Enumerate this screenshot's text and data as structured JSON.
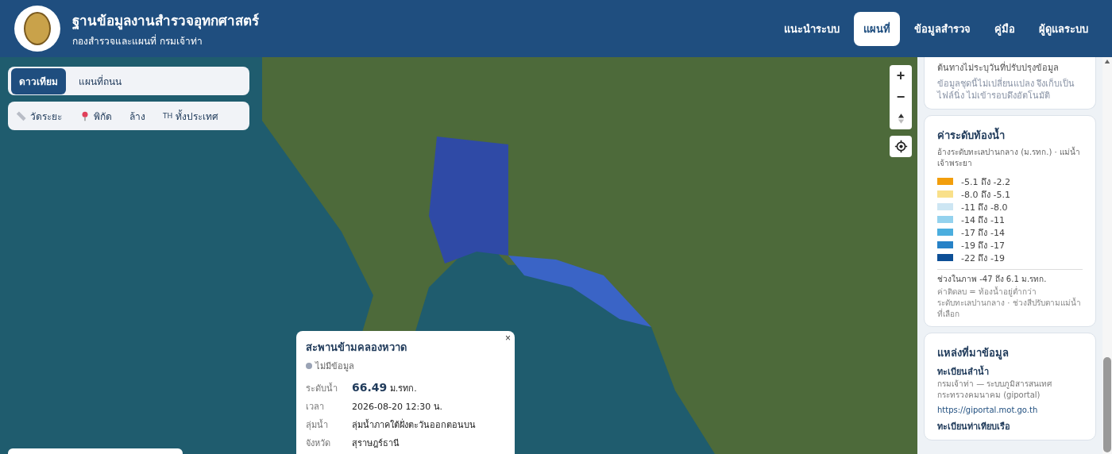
{
  "header": {
    "title": "ฐานข้อมูลงานสำรวจอุทกศาสตร์",
    "subtitle": "กองสำรวจและแผนที่ กรมเจ้าท่า"
  },
  "nav": [
    {
      "label": "แนะนำระบบ",
      "selected": false
    },
    {
      "label": "แผนที่",
      "selected": true
    },
    {
      "label": "ข้อมูลสำรวจ",
      "selected": false
    },
    {
      "label": "คู่มือ",
      "selected": false
    },
    {
      "label": "ผู้ดูแลระบบ",
      "selected": false
    }
  ],
  "basemap_tabs": [
    {
      "label": "ดาวเทียม",
      "selected": true
    },
    {
      "label": "แผนที่ถนน",
      "selected": false
    }
  ],
  "tools": [
    {
      "kind": "measure",
      "label": "วัดระยะ"
    },
    {
      "kind": "pin",
      "label": "พิกัด"
    },
    {
      "kind": "plain",
      "label": "ล้าง"
    },
    {
      "kind": "country",
      "prefix": "TH",
      "label": "ทั้งประเทศ"
    }
  ],
  "map_controls": {
    "zoom_in": "+",
    "zoom_out": "−"
  },
  "popup": {
    "title": "สะพานข้ามคลองหวาด",
    "status": "ไม่มีข้อมูล",
    "close": "×",
    "rows": [
      {
        "label": "ระดับน้ำ",
        "value": "66.49",
        "unit": "ม.รทก.",
        "kind": "level"
      },
      {
        "label": "เวลา",
        "value": "2026-08-20 12:30 น.",
        "kind": "text"
      },
      {
        "label": "ลุ่มน้ำ",
        "value": "ลุ่มน้ำภาคใต้ฝั่งตะวันออกตอนบน",
        "kind": "text"
      },
      {
        "label": "จังหวัด",
        "value": "สุราษฎร์ธานี",
        "kind": "text"
      }
    ]
  },
  "sidebar": {
    "note_card": {
      "lines": [
        "ต้นทางไม่ระบุวันที่ปรับปรุงข้อมูล",
        "ข้อมูลชุดนี้ไม่เปลี่ยนแปลง จึงเก็บเป็นไฟล์นิ่ง ไม่เข้ารอบดึงอัตโนมัติ"
      ]
    },
    "legend": {
      "title": "ค่าระดับท้องน้ำ",
      "subtitle": "อ้างระดับทะเลปานกลาง (ม.รทก.) · แม่น้ำเจ้าพระยา",
      "items": [
        {
          "label": "-5.1 ถึง -2.2",
          "color": "#f29e0c"
        },
        {
          "label": "-8.0 ถึง -5.1",
          "color": "#f9e08a"
        },
        {
          "label": "-11 ถึง -8.0",
          "color": "#cde6f3"
        },
        {
          "label": "-14 ถึง -11",
          "color": "#94d2ee"
        },
        {
          "label": "-17 ถึง -14",
          "color": "#4baede"
        },
        {
          "label": "-19 ถึง -17",
          "color": "#2782c7"
        },
        {
          "label": "-22 ถึง -19",
          "color": "#0d4f96"
        }
      ],
      "range": "ช่วงในภาพ -47 ถึง 6.1 ม.รทก.",
      "note": "ค่าติดลบ = ท้องน้ำอยู่ต่ำกว่าระดับทะเลปานกลาง · ช่วงสีปรับตามแม่น้ำที่เลือก"
    },
    "sources": {
      "title": "แหล่งที่มาข้อมูล",
      "items": [
        {
          "name": "ทะเบียนลำน้ำ",
          "desc": "กรมเจ้าท่า — ระบบภูมิสารสนเทศกระทรวงคมนาคม (giportal)",
          "link": "https://giportal.mot.go.th"
        },
        {
          "name": "ทะเบียนท่าเทียบเรือ"
        }
      ]
    }
  }
}
